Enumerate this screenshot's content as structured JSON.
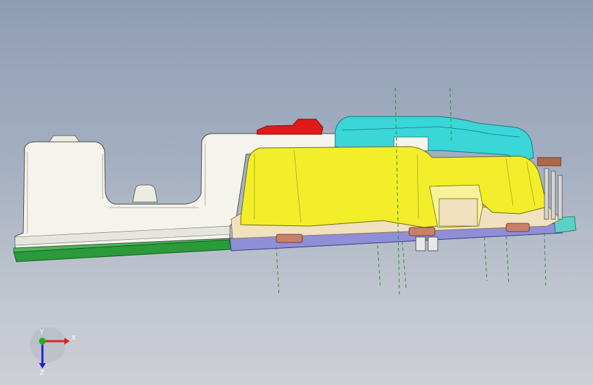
{
  "viewport": {
    "background_top": "#8f9db4",
    "background_bottom": "#cdd0d4"
  },
  "model": {
    "parts": [
      {
        "name": "white-housing",
        "color": "#f4f4ec"
      },
      {
        "name": "green-base-plate",
        "color": "#2a9a3a"
      },
      {
        "name": "yellow-cover",
        "color": "#f2ee2a"
      },
      {
        "name": "cyan-part",
        "color": "#3ad6d8"
      },
      {
        "name": "red-part",
        "color": "#e01a1a"
      },
      {
        "name": "purple-base-plate",
        "color": "#8f8fd8"
      },
      {
        "name": "teal-end-plate",
        "color": "#5ad0c8"
      },
      {
        "name": "beige-inner-part",
        "color": "#f1e1be"
      }
    ],
    "axis_lines_color": "#2e8b2e"
  },
  "triad": {
    "x_label": "X",
    "y_label": "Y",
    "z_label": "Z",
    "x_color": "#e02020",
    "y_color": "#20b020",
    "z_color": "#2020d0"
  }
}
